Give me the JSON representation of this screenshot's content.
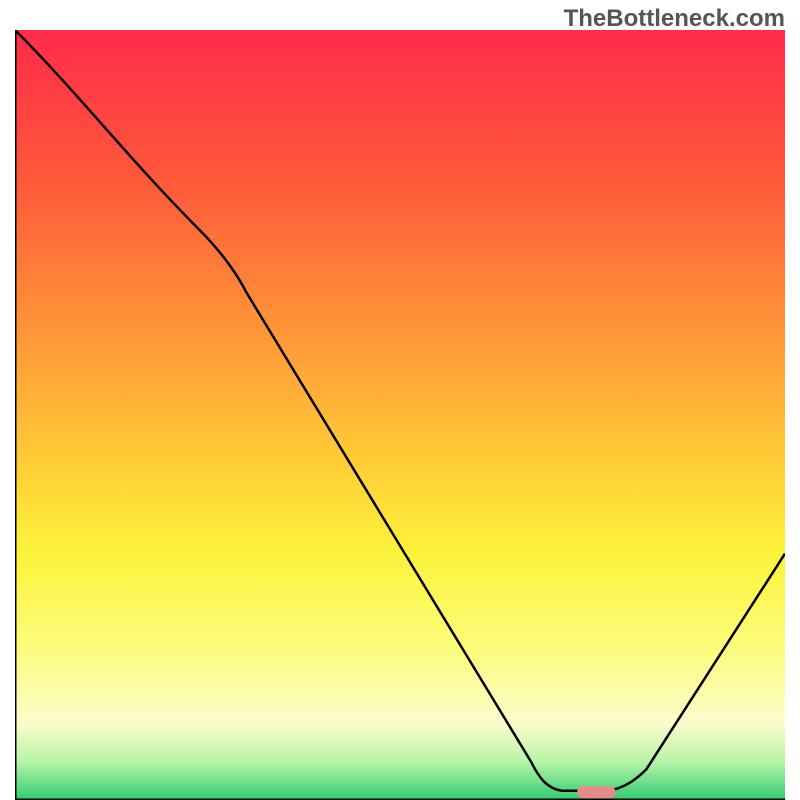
{
  "watermark": "TheBottleneck.com",
  "chart_data": {
    "type": "line",
    "title": "",
    "xlabel": "",
    "ylabel": "",
    "xlim": [
      0,
      100
    ],
    "ylim": [
      0,
      100
    ],
    "background_gradient": {
      "stops": [
        {
          "offset": 0,
          "color": "#ff2b4a"
        },
        {
          "offset": 20,
          "color": "#ff5a3a"
        },
        {
          "offset": 40,
          "color": "#ff9838"
        },
        {
          "offset": 55,
          "color": "#ffc936"
        },
        {
          "offset": 68,
          "color": "#fcf33a"
        },
        {
          "offset": 80,
          "color": "#fcfc7a"
        },
        {
          "offset": 90,
          "color": "#fcfccc"
        },
        {
          "offset": 95,
          "color": "#b8f5a8"
        },
        {
          "offset": 100,
          "color": "#2ecc71"
        }
      ]
    },
    "curve_points": [
      {
        "x": 0,
        "y": 100
      },
      {
        "x": 13,
        "y": 85
      },
      {
        "x": 24,
        "y": 74
      },
      {
        "x": 30,
        "y": 66
      },
      {
        "x": 68,
        "y": 4
      },
      {
        "x": 69,
        "y": 2
      },
      {
        "x": 70,
        "y": 1.5
      },
      {
        "x": 73,
        "y": 1
      },
      {
        "x": 77,
        "y": 1
      },
      {
        "x": 80,
        "y": 1.5
      },
      {
        "x": 82,
        "y": 3
      },
      {
        "x": 100,
        "y": 32
      }
    ],
    "marker": {
      "x_start": 73,
      "x_end": 78,
      "y": 1,
      "color": "#e88a8a"
    },
    "axis_color": "#000000"
  }
}
